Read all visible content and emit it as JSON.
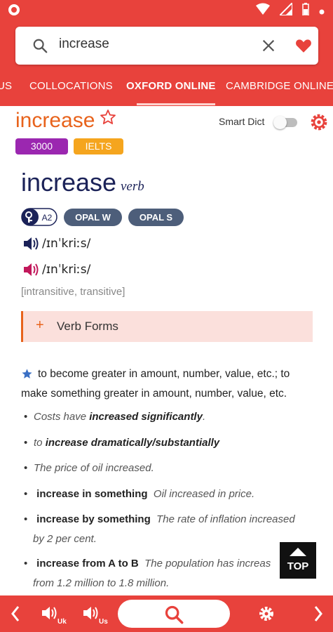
{
  "colors": {
    "primary": "#e8423c",
    "accent_orange": "#e8631c",
    "navy": "#1b2258",
    "opal": "#4d5e7a"
  },
  "search": {
    "query": "increase"
  },
  "tabs": [
    {
      "label": "US"
    },
    {
      "label": "COLLOCATIONS"
    },
    {
      "label": "OXFORD ONLINE",
      "active": true
    },
    {
      "label": "CAMBRIDGE ONLINE"
    }
  ],
  "entry": {
    "headword_small": "increase",
    "badges": [
      "3000",
      "IELTS"
    ],
    "smart_dict_label": "Smart Dict",
    "smart_dict_on": false,
    "headword": "increase",
    "pos": "verb",
    "level": "A2",
    "opal": [
      "OPAL W",
      "OPAL S"
    ],
    "pron_uk": "/ɪnˈkriːs/",
    "pron_us": "/ɪnˈkriːs/",
    "grammar": "[intransitive, transitive]",
    "verb_forms_label": "Verb Forms",
    "definition": "to become greater in amount, number, value, etc.; to make something greater in amount, number, value, etc."
  },
  "examples": [
    {
      "pre": "Costs have ",
      "bold": "increased significantly",
      "post": "."
    },
    {
      "pre": "to ",
      "bold": "increase dramatically/substantially",
      "post": ""
    },
    {
      "pre": "The price of oil increased.",
      "bold": "",
      "post": ""
    },
    {
      "pattern": "increase in something",
      "text": "Oil increased in price."
    },
    {
      "pattern": "increase by something",
      "text": "The rate of inflation increased",
      "text2": "by 2 per cent."
    },
    {
      "pattern": "increase from A to B",
      "text": "The population has increas",
      "text2": "from 1.2 million to 1.8 million."
    }
  ],
  "top_button": {
    "label": "TOP"
  },
  "bottom_bar": {
    "uk_sub": "Uk",
    "us_sub": "Us"
  }
}
